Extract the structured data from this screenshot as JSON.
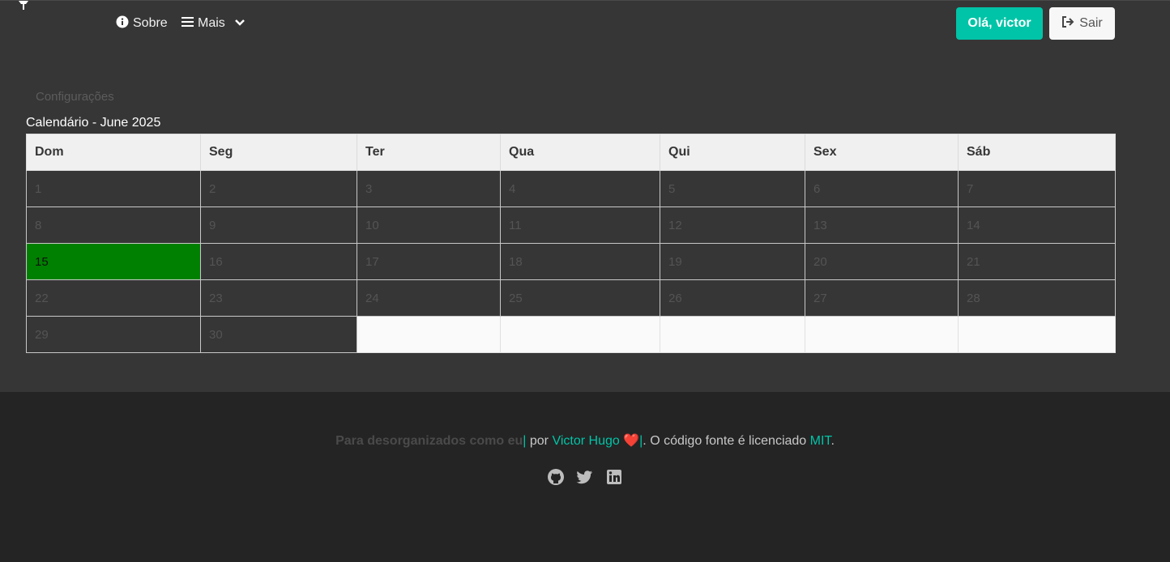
{
  "nav": {
    "sobre": "Sobre",
    "mais": "Mais",
    "greeting": "Olá, victor",
    "logout": "Sair"
  },
  "settings_link": "Configurações",
  "calendar": {
    "title": "Calendário - June 2025",
    "weekdays": [
      "Dom",
      "Seg",
      "Ter",
      "Qua",
      "Qui",
      "Sex",
      "Sáb"
    ],
    "weeks": [
      [
        "1",
        "2",
        "3",
        "4",
        "5",
        "6",
        "7"
      ],
      [
        "8",
        "9",
        "10",
        "11",
        "12",
        "13",
        "14"
      ],
      [
        "15",
        "16",
        "17",
        "18",
        "19",
        "20",
        "21"
      ],
      [
        "22",
        "23",
        "24",
        "25",
        "26",
        "27",
        "28"
      ],
      [
        "29",
        "30",
        "",
        "",
        "",
        "",
        ""
      ]
    ],
    "highlighted_day": "15",
    "highlight_color": "#008000"
  },
  "footer": {
    "tagline": "Para desorganizados como eu",
    "separator": "|",
    "by": " por ",
    "author": "Victor Hugo",
    "heart": "❤️",
    "license_prefix": ". O código fonte é licenciado ",
    "license": "MIT",
    "period": ".",
    "socials": [
      "github-icon",
      "twitter-icon",
      "linkedin-icon"
    ]
  },
  "colors": {
    "accent": "#00c4a7",
    "background": "#363636",
    "footer_bg": "#242424"
  }
}
